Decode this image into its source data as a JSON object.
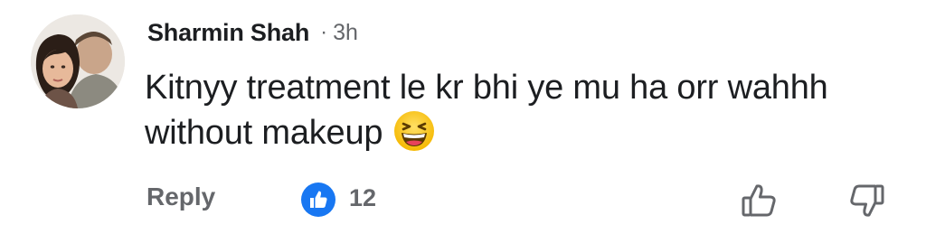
{
  "comment": {
    "author": "Sharmin Shah",
    "separator": "·",
    "time": "3h",
    "text": "Kitnyy treatment le kr bhi ye mu ha orr wahhh without makeup",
    "emoji": "grinning-squinting-face",
    "reply_label": "Reply",
    "like_count": "12"
  },
  "colors": {
    "text_primary": "#1c1e21",
    "text_secondary": "#65676b",
    "like_blue": "#1877f2",
    "emoji_yellow": "#ffcc33"
  },
  "icons": {
    "avatar": "profile-photo",
    "like_badge": "thumbs-up-badge-icon",
    "like_action": "thumbs-up-outline-icon",
    "dislike_action": "thumbs-down-outline-icon"
  }
}
